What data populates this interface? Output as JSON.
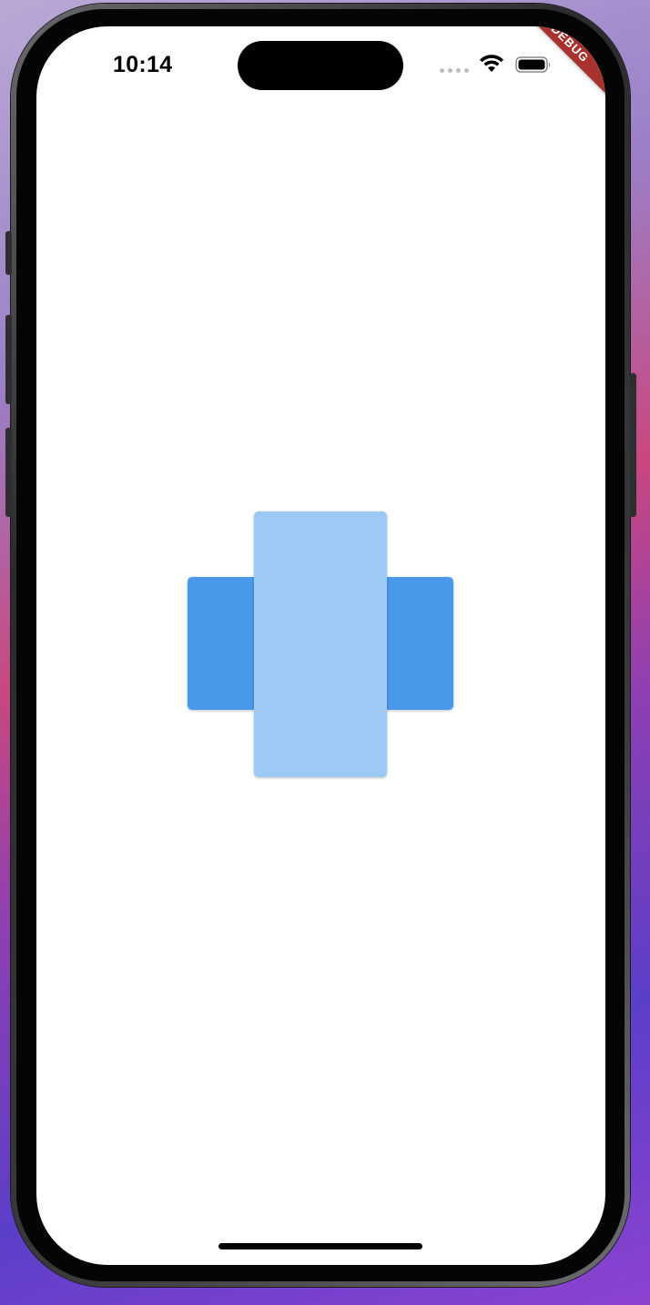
{
  "status_bar": {
    "time": "10:14",
    "wifi_icon": "wifi-icon",
    "battery_icon": "battery-icon",
    "signal_icon": "cellular-signal-icon"
  },
  "debug_banner": {
    "label": "DEBUG",
    "color": "#a8332e"
  },
  "cards": {
    "left": {
      "color": "#4a98ea"
    },
    "center": {
      "color": "#9fc9f5"
    },
    "right": {
      "color": "#4a98ea"
    }
  },
  "colors": {
    "screen_background": "#ffffff",
    "primary_blue": "#4a98ea",
    "light_blue": "#9fc9f5"
  }
}
